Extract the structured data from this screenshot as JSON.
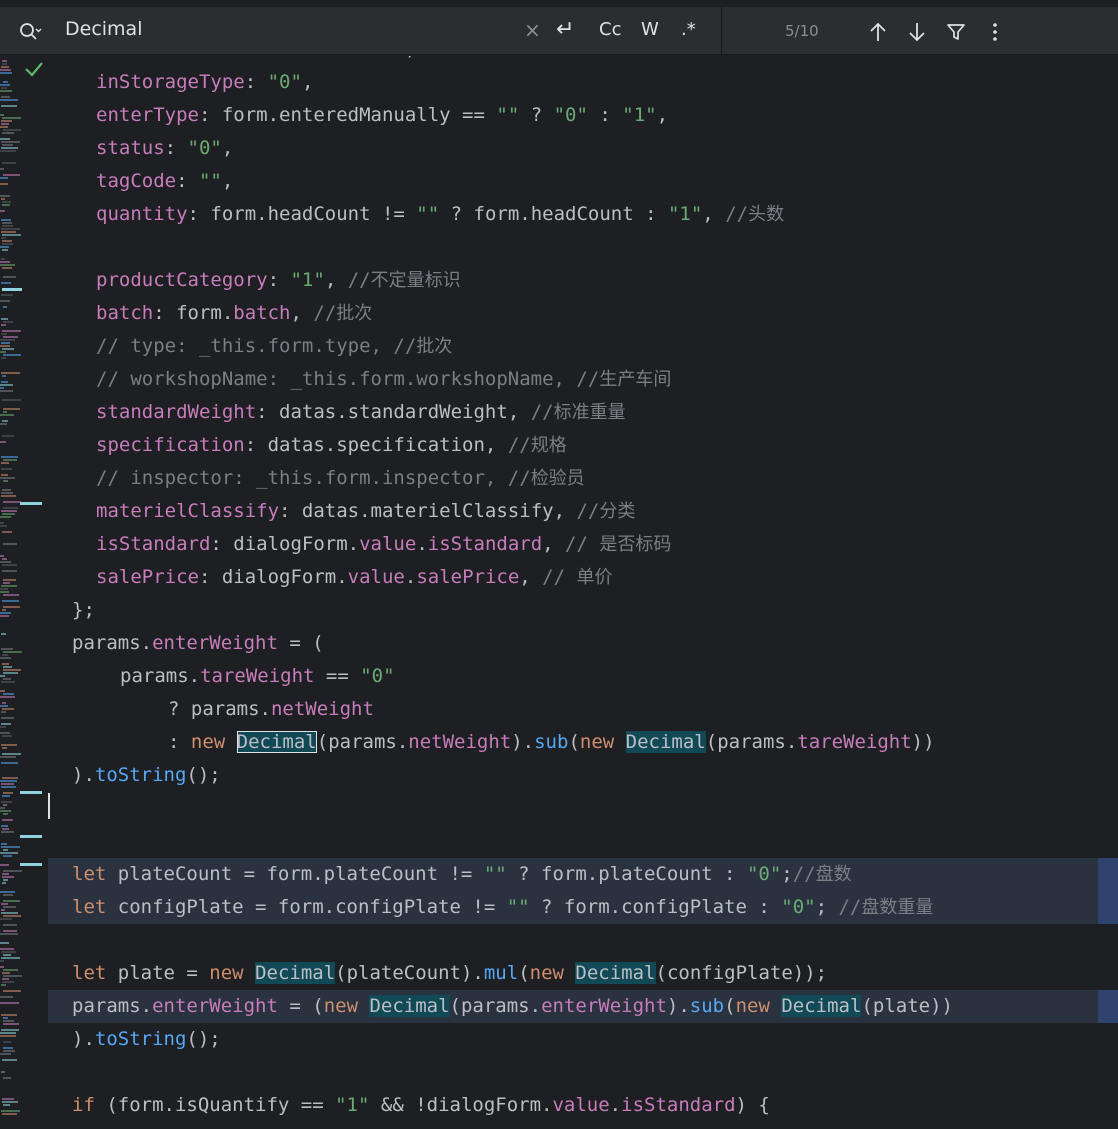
{
  "search": {
    "query": "Decimal",
    "clear_icon": "×",
    "options": {
      "newline": "↵",
      "match_case": "Cc",
      "words": "W",
      "regex": ".*"
    },
    "match_count": "5/10",
    "icons": [
      "search-icon",
      "clear-icon",
      "newline-icon",
      "match-case-icon",
      "words-icon",
      "regex-icon",
      "arrow-up-icon",
      "arrow-down-icon",
      "filter-icon",
      "more-icon"
    ]
  },
  "colors": {
    "background": "#1e1f22",
    "property": "#c77dbb",
    "string": "#6aab73",
    "keyword": "#cf8e6d",
    "function": "#56a8f5",
    "comment": "#7a7e85",
    "match": "#114957",
    "default": "#bcbec4"
  },
  "code": {
    "l01": [
      "    statusCode: formMatchInCode,"
    ],
    "l02": {
      "prop": "inStorageType",
      "rest": ": ",
      "str": "\"0\"",
      "end": ","
    },
    "l03": {
      "prop": "enterType",
      "p1": ": form.enteredManually == ",
      "s1": "\"\"",
      "p2": " ? ",
      "s2": "\"0\"",
      "p3": " : ",
      "s3": "\"1\"",
      "end": ","
    },
    "l04": {
      "prop": "status",
      "rest": ": ",
      "str": "\"0\"",
      "end": ","
    },
    "l05": {
      "prop": "tagCode",
      "rest": ": ",
      "str": "\"\"",
      "end": ","
    },
    "l06": {
      "prop": "quantity",
      "p1": ": form.headCount != ",
      "s1": "\"\"",
      "p2": " ? form.headCount : ",
      "s2": "\"1\"",
      "p3": ", ",
      "cm": "//",
      "cn": "头数"
    },
    "l08": {
      "prop": "productCategory",
      "rest": ": ",
      "str": "\"1\"",
      "p3": ", ",
      "cm": "//",
      "cn": "不定量标识"
    },
    "l09": {
      "prop": "batch",
      "rest": ": form.",
      "prop2": "batch",
      "p3": ", ",
      "cm": "//",
      "cn": "批次"
    },
    "l10": {
      "cm": "// type: _this.form.type, //",
      "cn": "批次"
    },
    "l11": {
      "cm": "// workshopName: _this.form.workshopName, //",
      "cn": "生产车间"
    },
    "l12": {
      "prop": "standardWeight",
      "rest": ": datas.standardWeight, ",
      "cm": "//",
      "cn": "标准重量"
    },
    "l13": {
      "prop": "specification",
      "rest": ": datas.specification, ",
      "cm": "//",
      "cn": "规格"
    },
    "l14": {
      "cm": "// inspector: _this.form.inspector, //",
      "cn": "检验员"
    },
    "l15": {
      "prop": "materielClassify",
      "rest": ": datas.materielClassify, ",
      "cm": "//",
      "cn": "分类"
    },
    "l16": {
      "prop": "isStandard",
      "rest": ": dialogForm.",
      "prop2": "value",
      "dot": ".",
      "prop3": "isStandard",
      "p3": ", ",
      "cm": "// ",
      "cn": "是否标码"
    },
    "l17": {
      "prop": "salePrice",
      "rest": ": dialogForm.",
      "prop2": "value",
      "dot": ".",
      "prop3": "salePrice",
      "p3": ", ",
      "cm": "// ",
      "cn": "单价"
    },
    "l18": "};",
    "l19": {
      "a": "params.",
      "prop": "enterWeight",
      "b": " = ("
    },
    "l20": {
      "a": "params.",
      "prop": "tareWeight",
      "b": " == ",
      "str": "\"0\""
    },
    "l21": {
      "a": "? params.",
      "prop": "netWeight"
    },
    "l22": {
      "a": ": ",
      "kw": "new",
      "m1": "Decimal",
      "b": "(params.",
      "prop": "netWeight",
      "c": ").",
      "fn": "sub",
      "d": "(",
      "kw2": "new",
      "m2": "Decimal",
      "e": "(params.",
      "prop2": "tareWeight",
      "f": "))"
    },
    "l23": {
      "a": ").",
      "fn": "toString",
      "b": "();"
    },
    "l26": {
      "kw": "let",
      "a": " plateCount = form.plateCount != ",
      "s1": "\"\"",
      "b": " ? form.plateCount : ",
      "s2": "\"0\"",
      "c": ";",
      "cm": "//",
      "cn": "盘数"
    },
    "l27": {
      "kw": "let",
      "a": " configPlate = form.configPlate != ",
      "s1": "\"\"",
      "b": " ? form.configPlate : ",
      "s2": "\"0\"",
      "c": "; ",
      "cm": "//",
      "cn": "盘数重量"
    },
    "l29": {
      "kw": "let",
      "a": " plate = ",
      "kw2": "new",
      "m1": "Decimal",
      "b": "(plateCount).",
      "fn": "mul",
      "c": "(",
      "kw3": "new",
      "m2": "Decimal",
      "d": "(configPlate));"
    },
    "l30": {
      "a": "params.",
      "prop": "enterWeight",
      "b": " = (",
      "kw": "new",
      "m1": "Decimal",
      "c": "(params.",
      "prop2": "enterWeight",
      "d": ").",
      "fn": "sub",
      "e": "(",
      "kw2": "new",
      "m2": "Decimal",
      "f": "(plate))"
    },
    "l31": {
      "a": ").",
      "fn": "toString",
      "b": "();"
    },
    "l33": {
      "kw": "if",
      "a": " (form.isQuantify == ",
      "str": "\"1\"",
      "b": " && !dialogForm.",
      "prop": "value",
      "dot": ".",
      "prop2": "isStandard",
      "c": ") {"
    }
  }
}
